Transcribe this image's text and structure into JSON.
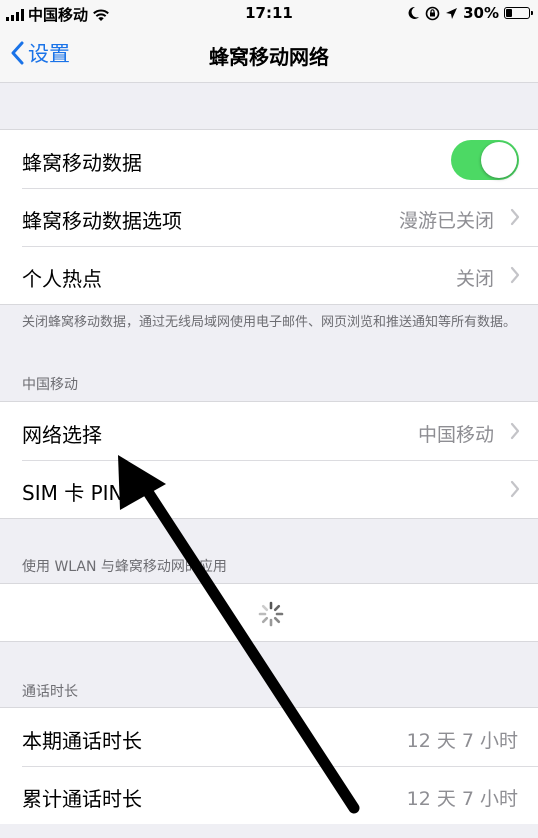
{
  "status_bar": {
    "carrier": "中国移动",
    "time": "17:11",
    "battery": "30%",
    "battery_level": 0.3,
    "icons": [
      "signal-bars-icon",
      "wifi-icon",
      "moon-icon",
      "orientation-lock-icon",
      "location-arrow-icon",
      "battery-icon"
    ]
  },
  "nav": {
    "back_label": "设置",
    "title": "蜂窝移动网络"
  },
  "group1": {
    "cellular_data_label": "蜂窝移动数据",
    "cellular_data_on": true,
    "data_options_label": "蜂窝移动数据选项",
    "data_options_value": "漫游已关闭",
    "hotspot_label": "个人热点",
    "hotspot_value": "关闭"
  },
  "footnote1": "关闭蜂窝移动数据，通过无线局域网使用电子邮件、网页浏览和推送通知等所有数据。",
  "carrier_header": "中国移动",
  "group2": {
    "network_selection_label": "网络选择",
    "network_selection_value": "中国移动",
    "sim_pin_label": "SIM 卡 PIN"
  },
  "wlan_apps_header": "使用 WLAN 与蜂窝移动网的应用",
  "call_time_header": "通话时长",
  "group4": {
    "current_period_label": "本期通话时长",
    "current_period_value": "12 天 7 小时",
    "lifetime_label": "累计通话时长",
    "lifetime_value": "12 天 7 小时"
  },
  "colors": {
    "accent": "#1a73e8",
    "toggle_on": "#4cd964",
    "background": "#efeff4"
  }
}
